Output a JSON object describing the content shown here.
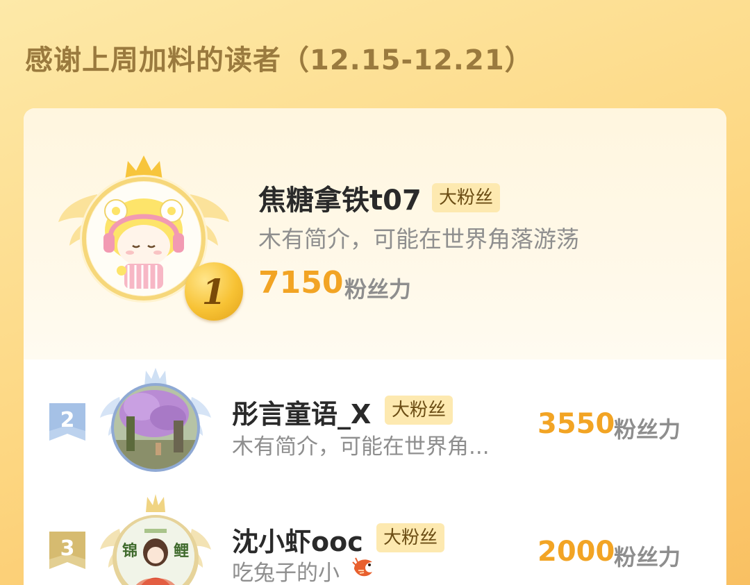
{
  "page": {
    "title": "感谢上周加料的读者（12.15-12.21）"
  },
  "readers": [
    {
      "rank": "1",
      "name": "焦糖拿铁t07",
      "badge": "大粉丝",
      "bio": "木有简介，可能在世界角落游荡",
      "score": "7150",
      "score_unit": "粉丝力",
      "avatar_icon": "cartoon-girl-avatar"
    },
    {
      "rank": "2",
      "name": "彤言童语_X",
      "badge": "大粉丝",
      "bio": "木有简介，可能在世界角...",
      "score": "3550",
      "score_unit": "粉丝力",
      "avatar_icon": "wisteria-tree-photo"
    },
    {
      "rank": "3",
      "name": "沈小虾ooc",
      "badge": "大粉丝",
      "bio": "吃兔子的小",
      "bio_icon": "shrimp-icon",
      "score": "2000",
      "score_unit": "粉丝力",
      "avatar_icon": "koi-girl-avatar",
      "avatar_text": [
        "锦",
        "鲤"
      ]
    }
  ],
  "colors": {
    "accent": "#f2a424",
    "gold": "#f7c234",
    "silver": "#a9c4e6",
    "bronze": "#d9bf78"
  }
}
